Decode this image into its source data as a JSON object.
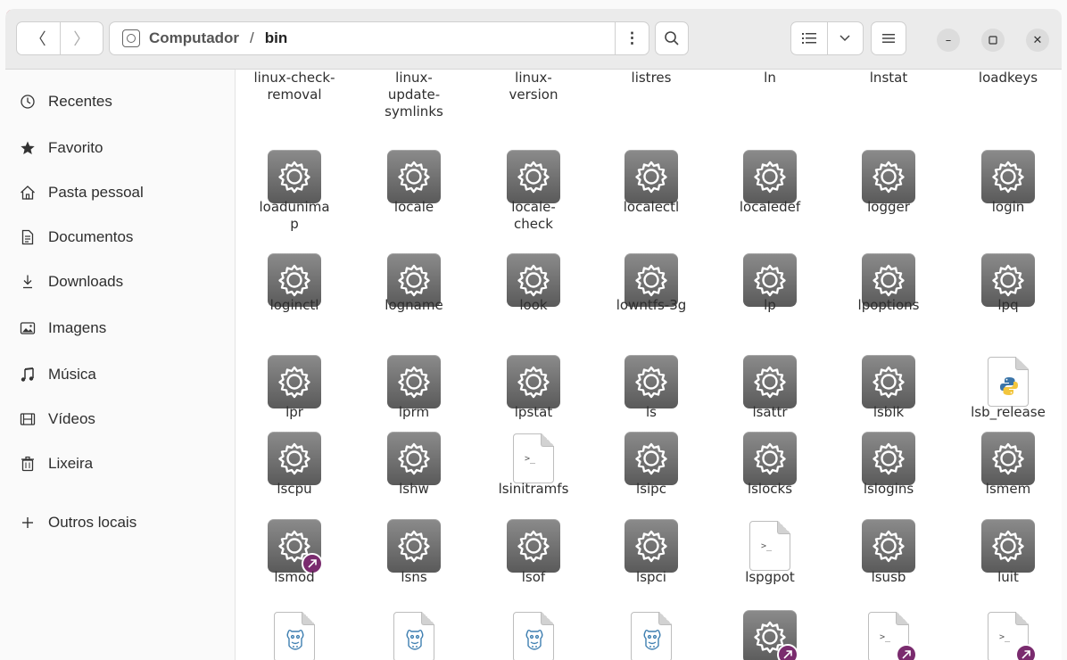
{
  "window": {
    "path": {
      "root": "Computador",
      "current": "bin"
    }
  },
  "sidebar": {
    "items": [
      {
        "label": "Recentes",
        "icon": "clock-icon"
      },
      {
        "label": "Favorito",
        "icon": "star-icon"
      },
      {
        "label": "Pasta pessoal",
        "icon": "home-icon"
      },
      {
        "label": "Documentos",
        "icon": "document-icon"
      },
      {
        "label": "Downloads",
        "icon": "download-icon"
      },
      {
        "label": "Imagens",
        "icon": "image-icon"
      },
      {
        "label": "Música",
        "icon": "music-icon"
      },
      {
        "label": "Vídeos",
        "icon": "video-icon"
      },
      {
        "label": "Lixeira",
        "icon": "trash-icon"
      },
      {
        "label": "Outros locais",
        "icon": "plus-icon"
      }
    ]
  },
  "files": {
    "row0": [
      "linux-check-removal",
      "linux-update-symlinks",
      "linux-version",
      "listres",
      "ln",
      "lnstat",
      "loadkeys"
    ],
    "row1": [
      "loadunimap",
      "locale",
      "locale-check",
      "localectl",
      "localedef",
      "logger",
      "login"
    ],
    "row2": [
      "loginctl",
      "logname",
      "look",
      "lowntfs-3g",
      "lp",
      "lpoptions",
      "lpq"
    ],
    "row3": [
      "lpr",
      "lprm",
      "lpstat",
      "ls",
      "lsattr",
      "lsblk",
      "lsb_release"
    ],
    "row4": [
      "lscpu",
      "lshw",
      "lsinitramfs",
      "lsipc",
      "lslocks",
      "lslogins",
      "lsmem"
    ],
    "row5": [
      "lsmod",
      "lsns",
      "lsof",
      "lspci",
      "lspgpot",
      "lsusb",
      "luit"
    ],
    "row1_display": [
      "loadunima\np",
      "locale",
      "locale-\ncheck",
      "localectl",
      "localedef",
      "logger",
      "login"
    ],
    "row0_display": [
      "linux-check-\nremoval",
      "linux-\nupdate-\nsymlinks",
      "linux-\nversion",
      "listres",
      "ln",
      "lnstat",
      "loadkeys"
    ]
  },
  "icon_kinds": {
    "row1": [
      "gear",
      "gear",
      "gear",
      "gear",
      "gear",
      "gear",
      "gear"
    ],
    "row2": [
      "gear",
      "gear",
      "gear",
      "gear",
      "gear",
      "gear",
      "gear"
    ],
    "row3": [
      "gear",
      "gear",
      "gear",
      "gear",
      "gear",
      "gear",
      "python"
    ],
    "row4": [
      "gear",
      "gear",
      "script",
      "gear",
      "gear",
      "gear",
      "gear"
    ],
    "row5": [
      "gear-link",
      "gear",
      "gear",
      "gear",
      "script",
      "gear",
      "gear"
    ],
    "row6": [
      "camel",
      "camel",
      "camel",
      "camel",
      "gear-link",
      "script-link",
      "script-link"
    ]
  },
  "colors": {
    "accent": "#7a2b6e",
    "close": "#c7162b"
  }
}
